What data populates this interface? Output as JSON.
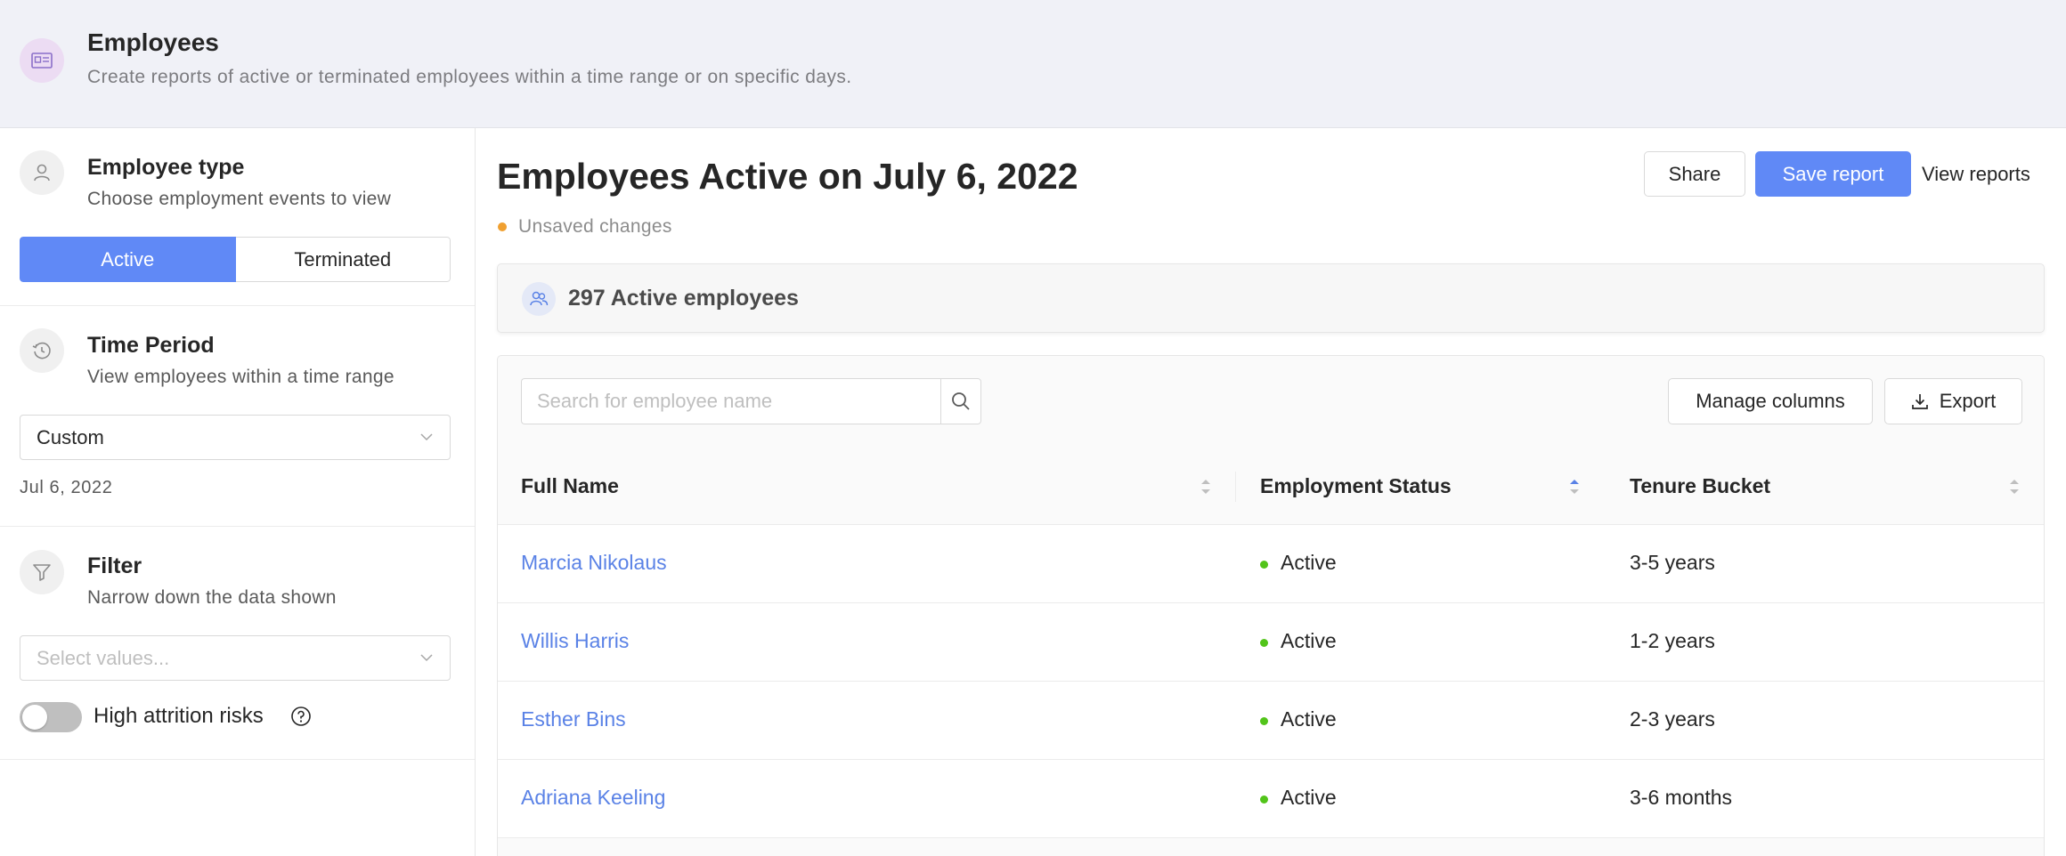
{
  "header": {
    "title": "Employees",
    "subtitle": "Create reports of active or terminated employees within a time range or on specific days.",
    "icon": "id-card-icon"
  },
  "sidebar": {
    "employee_type": {
      "title": "Employee type",
      "subtitle": "Choose employment events to view",
      "icon": "person-icon",
      "options": [
        "Active",
        "Terminated"
      ],
      "selected": "Active"
    },
    "time_period": {
      "title": "Time Period",
      "subtitle": "View employees within a time range",
      "icon": "clock-history-icon",
      "select_value": "Custom",
      "date": "Jul 6, 2022"
    },
    "filter": {
      "title": "Filter",
      "subtitle": "Narrow down the data shown",
      "icon": "funnel-icon",
      "select_placeholder": "Select values...",
      "toggle_label": "High attrition risks",
      "toggle_on": false
    }
  },
  "main": {
    "title": "Employees Active on July 6, 2022",
    "unsaved": "Unsaved changes",
    "actions": {
      "share": "Share",
      "save": "Save report",
      "view": "View reports"
    },
    "summary": "297 Active employees",
    "search_placeholder": "Search for employee name",
    "manage_columns": "Manage columns",
    "export": "Export",
    "columns": [
      "Full Name",
      "Employment Status",
      "Tenure Bucket"
    ],
    "rows": [
      {
        "name": "Marcia Nikolaus",
        "status": "Active",
        "tenure": "3-5 years"
      },
      {
        "name": "Willis Harris",
        "status": "Active",
        "tenure": "1-2 years"
      },
      {
        "name": "Esther Bins",
        "status": "Active",
        "tenure": "2-3 years"
      },
      {
        "name": "Adriana Keeling",
        "status": "Active",
        "tenure": "3-6 months"
      }
    ]
  },
  "colors": {
    "accent": "#6089f6",
    "link": "#5a82e6",
    "status_active": "#52c41a",
    "unsaved": "#f0a030",
    "header_bg": "#f0f1f7"
  }
}
